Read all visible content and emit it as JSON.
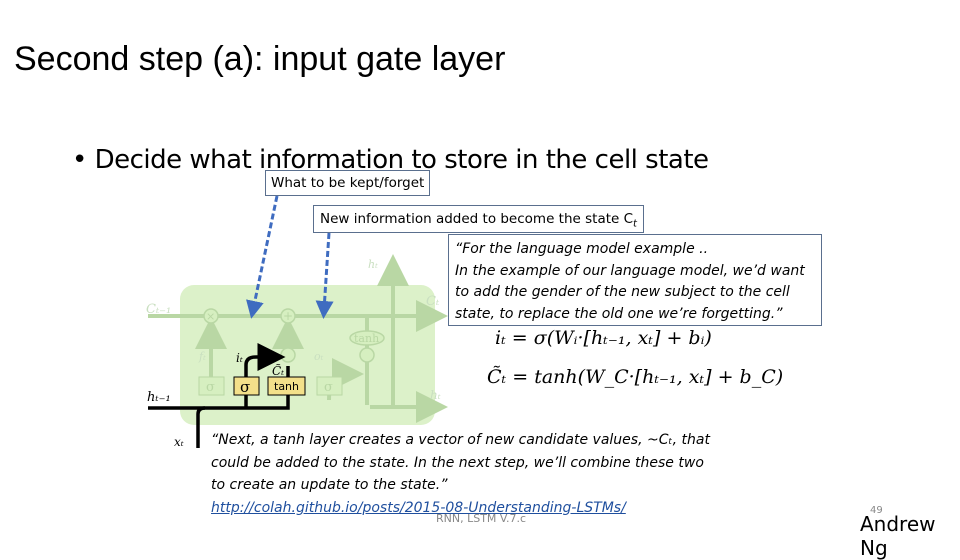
{
  "slide": {
    "title": "Second step (a): input gate layer",
    "bullet": "• Decide what information to store in  the cell state",
    "callouts": {
      "kept_forget": "What to be kept/forget",
      "new_info": "New information added to become the state C",
      "new_info_sub": "t",
      "language_model_line1": "“For the language model example ..",
      "language_model_line2": "In the example of our language model, we’d want",
      "language_model_line3": "to add the gender of the new subject to the cell",
      "language_model_line4": "state, to replace the old one we’re forgetting.”"
    },
    "equations": {
      "input_gate": "iₜ = σ(Wᵢ·[hₜ₋₁, xₜ]  +  bᵢ)",
      "candidate": "C̃ₜ = tanh(W_C·[hₜ₋₁, xₜ]  +  b_C)"
    },
    "quote": {
      "line1": "“Next, a tanh layer creates a vector of new candidate values, ~Cₜ, that",
      "line2": "could be added to the state. In the next step, we’ll combine these two",
      "line3": "to create an update to the state.”",
      "link": "http://colah.github.io/posts/2015-08-Understanding-LSTMs/"
    },
    "diagram": {
      "labels": {
        "c_prev": "Cₜ₋₁",
        "c_t": "Cₜ",
        "h_prev": "hₜ₋₁",
        "h_t": "hₜ",
        "h_t_top": "hₜ",
        "x_t": "xₜ",
        "f_t": "fₜ",
        "i_t": "iₜ",
        "c_tilde": "C̃ₜ",
        "o_t": "oₜ",
        "sigma": "σ",
        "tanh": "tanh",
        "times": "×",
        "plus": "+"
      },
      "colors": {
        "cell_bg": "#d6efc0",
        "faded": "#b9d7a4",
        "highlight_box": "#f3e08a",
        "arrow_blue": "#3f6cc0",
        "active_line": "#000000"
      }
    },
    "footer": "RNN, LSTM V.7.c",
    "page_number": "49",
    "author": "Andrew Ng"
  }
}
